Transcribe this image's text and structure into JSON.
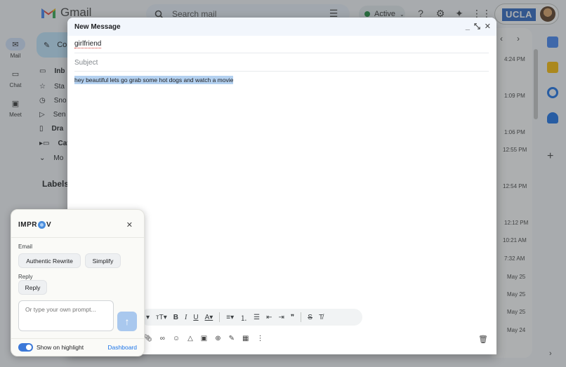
{
  "gmail": {
    "logo_text": "Gmail",
    "search_placeholder": "Search mail",
    "status": "Active",
    "org_badge": "UCLA",
    "nav": [
      {
        "label": "Mail"
      },
      {
        "label": "Chat"
      },
      {
        "label": "Meet"
      }
    ],
    "compose_label": "Co",
    "folders": [
      "Inb",
      "Sta",
      "Sno",
      "Sen",
      "Dra",
      "Cat",
      "Mo"
    ],
    "labels_heading": "Labels",
    "times": [
      "4:24 PM",
      "1:09 PM",
      "1:06 PM",
      "12:55 PM",
      "12:54 PM",
      "12:12 PM",
      "10:21 AM",
      "7:32 AM",
      "May 25",
      "May 25",
      "May 25",
      "May 24"
    ]
  },
  "compose": {
    "title": "New Message",
    "to_value": "girlfriend",
    "subject_placeholder": "Subject",
    "body_text": "hey beautiful lets go grab some hot dogs and watch a movie"
  },
  "improv": {
    "logo_pre": "IMPR",
    "logo_post": "V",
    "section_email": "Email",
    "btn_authentic": "Authentic Rewrite",
    "btn_simplify": "Simplify",
    "section_reply": "Reply",
    "btn_reply": "Reply",
    "prompt_placeholder": "Or type your own prompt...",
    "toggle_label": "Show on highlight",
    "dashboard_link": "Dashboard"
  }
}
